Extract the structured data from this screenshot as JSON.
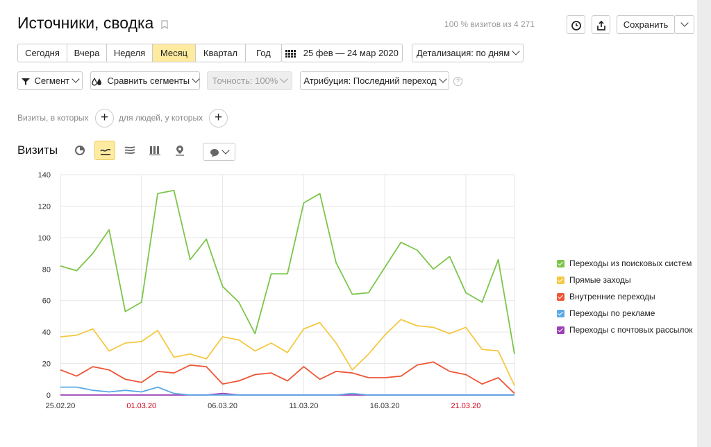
{
  "header": {
    "title": "Источники, сводка",
    "share_info": "100 % визитов из 4 271",
    "save_label": "Сохранить"
  },
  "periods": {
    "items": [
      "Сегодня",
      "Вчера",
      "Неделя",
      "Месяц",
      "Квартал",
      "Год"
    ],
    "active": "Месяц"
  },
  "date_range": "25 фев — 24 мар 2020",
  "detail": "Детализация: по дням",
  "filters": {
    "segment": "Сегмент",
    "compare": "Сравнить сегменты",
    "accuracy": "Точность: 100%",
    "attribution": "Атрибуция: Последний переход",
    "help": "?"
  },
  "conditions": {
    "visits_label": "Визиты, в которых",
    "people_label": "для людей, у которых",
    "add": "+"
  },
  "section_title": "Визиты",
  "view_icons": [
    "pie-icon",
    "line-icon",
    "area-icon",
    "column-icon",
    "map-icon"
  ],
  "chart_data": {
    "type": "line",
    "x": [
      "25.02.20",
      "26.02.20",
      "27.02.20",
      "28.02.20",
      "29.02.20",
      "01.03.20",
      "02.03.20",
      "03.03.20",
      "04.03.20",
      "05.03.20",
      "06.03.20",
      "07.03.20",
      "08.03.20",
      "09.03.20",
      "10.03.20",
      "11.03.20",
      "12.03.20",
      "13.03.20",
      "14.03.20",
      "15.03.20",
      "16.03.20",
      "17.03.20",
      "18.03.20",
      "19.03.20",
      "20.03.20",
      "21.03.20",
      "22.03.20",
      "23.03.20",
      "24.03.20"
    ],
    "tick_labels": [
      {
        "label": "25.02.20",
        "index": 0,
        "weekend": false
      },
      {
        "label": "01.03.20",
        "index": 5,
        "weekend": true
      },
      {
        "label": "06.03.20",
        "index": 10,
        "weekend": false
      },
      {
        "label": "11.03.20",
        "index": 15,
        "weekend": false
      },
      {
        "label": "16.03.20",
        "index": 20,
        "weekend": false
      },
      {
        "label": "21.03.20",
        "index": 25,
        "weekend": true
      }
    ],
    "ylim": [
      0,
      140
    ],
    "yticks": [
      0,
      20,
      40,
      60,
      80,
      100,
      120,
      140
    ],
    "grid": true,
    "legend_position": "right",
    "series": [
      {
        "name": "Переходы из поисковых систем",
        "color": "#7cc54a",
        "values": [
          82,
          79,
          90,
          105,
          53,
          59,
          128,
          130,
          86,
          99,
          69,
          59,
          39,
          77,
          77,
          122,
          128,
          84,
          64,
          65,
          81,
          97,
          92,
          80,
          88,
          65,
          59,
          86,
          26
        ]
      },
      {
        "name": "Прямые заходы",
        "color": "#f5c842",
        "values": [
          37,
          38,
          42,
          28,
          33,
          34,
          41,
          24,
          26,
          23,
          37,
          35,
          28,
          33,
          27,
          42,
          46,
          33,
          16,
          26,
          38,
          48,
          44,
          43,
          39,
          43,
          29,
          28,
          6
        ]
      },
      {
        "name": "Внутренние переходы",
        "color": "#ee5535",
        "values": [
          16,
          12,
          18,
          16,
          10,
          8,
          15,
          14,
          19,
          18,
          7,
          9,
          13,
          14,
          9,
          18,
          10,
          15,
          14,
          11,
          11,
          12,
          19,
          21,
          15,
          13,
          7,
          11,
          1
        ]
      },
      {
        "name": "Переходы по рекламе",
        "color": "#5aa9e6",
        "values": [
          5,
          5,
          3,
          2,
          3,
          2,
          5,
          1,
          0,
          0,
          0,
          0,
          0,
          0,
          0,
          0,
          0,
          0,
          1,
          0,
          0,
          0,
          0,
          0,
          0,
          0,
          0,
          0,
          0
        ]
      },
      {
        "name": "Переходы с почтовых рассылок",
        "color": "#9b3fb6",
        "values": [
          0,
          0,
          0,
          0,
          0,
          0,
          0,
          0,
          0,
          0,
          1,
          0,
          0,
          0,
          0,
          0,
          0,
          0,
          0,
          0,
          0,
          0,
          0,
          0,
          0,
          0,
          0,
          0,
          0
        ]
      }
    ]
  }
}
